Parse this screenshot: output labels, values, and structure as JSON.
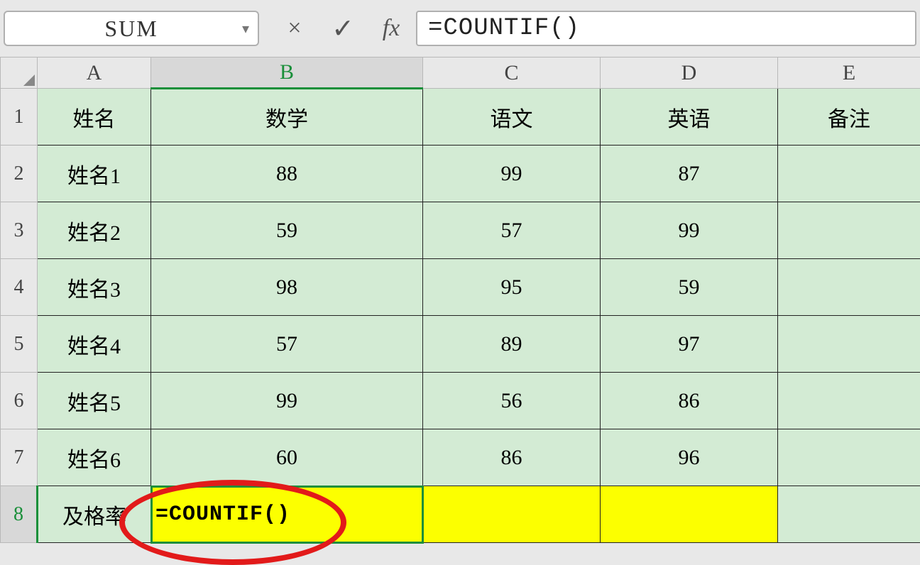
{
  "formula_bar": {
    "name_box": "SUM",
    "cancel_icon": "×",
    "confirm_icon": "✓",
    "fx_icon": "fx",
    "formula": "=COUNTIF()"
  },
  "columns": [
    "A",
    "B",
    "C",
    "D",
    "E"
  ],
  "rows": [
    "1",
    "2",
    "3",
    "4",
    "5",
    "6",
    "7",
    "8"
  ],
  "headers": {
    "A": "姓名",
    "B": "数学",
    "C": "语文",
    "D": "英语",
    "E": "备注"
  },
  "data": [
    {
      "A": "姓名1",
      "B": "88",
      "C": "99",
      "D": "87",
      "E": ""
    },
    {
      "A": "姓名2",
      "B": "59",
      "C": "57",
      "D": "99",
      "E": ""
    },
    {
      "A": "姓名3",
      "B": "98",
      "C": "95",
      "D": "59",
      "E": ""
    },
    {
      "A": "姓名4",
      "B": "57",
      "C": "89",
      "D": "97",
      "E": ""
    },
    {
      "A": "姓名5",
      "B": "99",
      "C": "56",
      "D": "86",
      "E": ""
    },
    {
      "A": "姓名6",
      "B": "60",
      "C": "86",
      "D": "96",
      "E": ""
    }
  ],
  "footer": {
    "label": "及格率",
    "active_cell_value": "=COUNTIF()"
  },
  "active_column": "B",
  "active_row": "8"
}
